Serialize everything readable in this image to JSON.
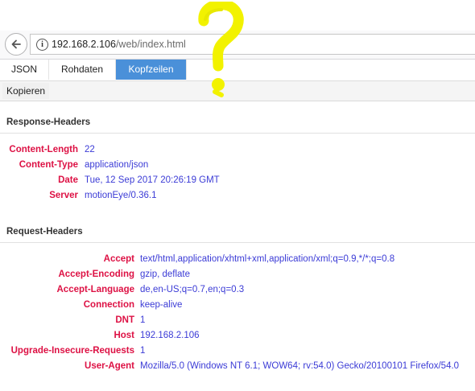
{
  "browser": {
    "url_host": "192.168.2.106",
    "url_path": "/web/index.html"
  },
  "tabs": [
    "JSON",
    "Rohdaten",
    "Kopfzeilen"
  ],
  "active_tab": "Kopfzeilen",
  "toolbar": {
    "copy_label": "Kopieren"
  },
  "response_headers": {
    "title": "Response-Headers",
    "items": [
      {
        "key": "Content-Length",
        "value": "22"
      },
      {
        "key": "Content-Type",
        "value": "application/json"
      },
      {
        "key": "Date",
        "value": "Tue, 12 Sep 2017 20:26:19 GMT"
      },
      {
        "key": "Server",
        "value": "motionEye/0.36.1"
      }
    ]
  },
  "request_headers": {
    "title": "Request-Headers",
    "items": [
      {
        "key": "Accept",
        "value": "text/html,application/xhtml+xml,application/xml;q=0.9,*/*;q=0.8"
      },
      {
        "key": "Accept-Encoding",
        "value": "gzip, deflate"
      },
      {
        "key": "Accept-Language",
        "value": "de,en-US;q=0.7,en;q=0.3"
      },
      {
        "key": "Connection",
        "value": "keep-alive"
      },
      {
        "key": "DNT",
        "value": "1"
      },
      {
        "key": "Host",
        "value": "192.168.2.106"
      },
      {
        "key": "Upgrade-Insecure-Requests",
        "value": "1"
      },
      {
        "key": "User-Agent",
        "value": "Mozilla/5.0 (Windows NT 6.1; WOW64; rv:54.0) Gecko/20100101 Firefox/54.0"
      }
    ]
  },
  "colors": {
    "accent": "#4a90d9",
    "header_key": "#dd1144",
    "header_value": "#3b3bd6",
    "annotation": "#f2f200"
  },
  "annotation_icon": "question-mark-scribble"
}
